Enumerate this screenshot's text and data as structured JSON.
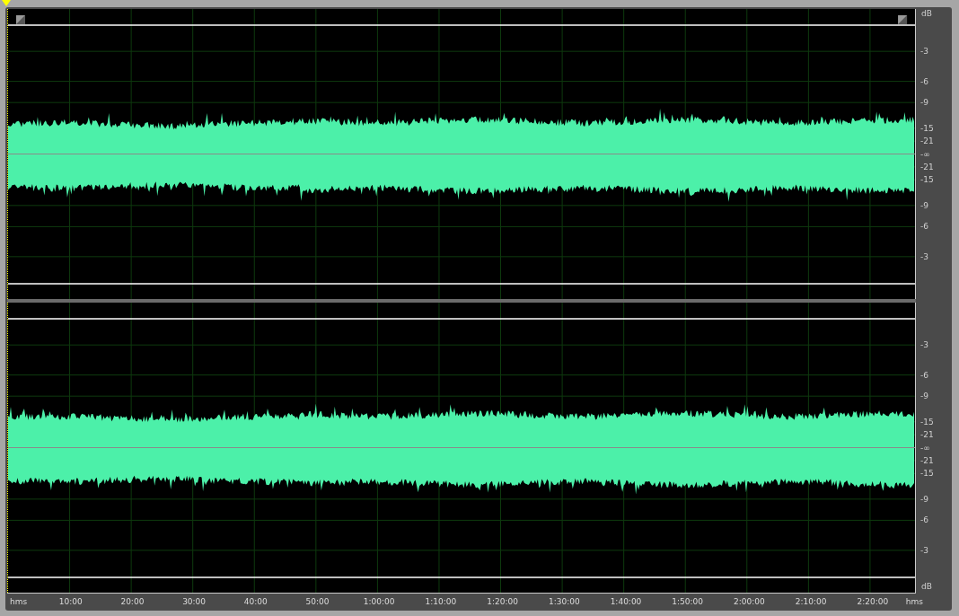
{
  "channels": [
    {
      "handles": true,
      "scale_unit_top": "dB",
      "scale": [
        "-3",
        "-6",
        "-9",
        "-15",
        "-21",
        "-∞",
        "-21",
        "-15",
        "-9",
        "-6",
        "-3"
      ]
    },
    {
      "handles": false,
      "scale_unit_bottom": "dB",
      "scale": [
        "-3",
        "-6",
        "-9",
        "-15",
        "-21",
        "-∞",
        "-21",
        "-15",
        "-9",
        "-6",
        "-3"
      ]
    }
  ],
  "timeline": {
    "unit_left": "hms",
    "labels": [
      "10:00",
      "20:00",
      "30:00",
      "40:00",
      "50:00",
      "1:00:00",
      "1:10:00",
      "1:20:00",
      "1:30:00",
      "1:40:00",
      "1:50:00",
      "2:00:00",
      "2:10:00",
      "2:20:00"
    ],
    "unit_right": "hms"
  }
}
